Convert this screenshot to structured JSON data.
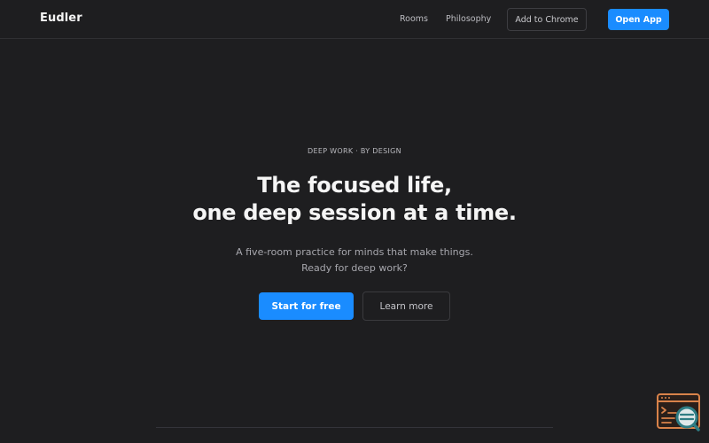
{
  "navbar": {
    "brand": "Eudler",
    "links": [
      {
        "label": "Rooms"
      },
      {
        "label": "Philosophy"
      }
    ],
    "add_to_chrome": "Add to Chrome",
    "open_app": "Open App"
  },
  "hero": {
    "eyebrow": "DEEP WORK · BY DESIGN",
    "headline_line1": "The focused life,",
    "headline_line2": "one deep session at a time.",
    "subtitle_line1": "A five-room practice for minds that make things.",
    "subtitle_line2": "Ready for deep work?",
    "primary_cta": "Start for free",
    "secondary_cta": "Learn more"
  },
  "widget": {
    "icon": "browser-search-icon"
  },
  "colors": {
    "background": "#1e1e20",
    "accent": "#1a8cff",
    "widget_orange": "#d9834a",
    "widget_teal": "#2f7d84"
  }
}
